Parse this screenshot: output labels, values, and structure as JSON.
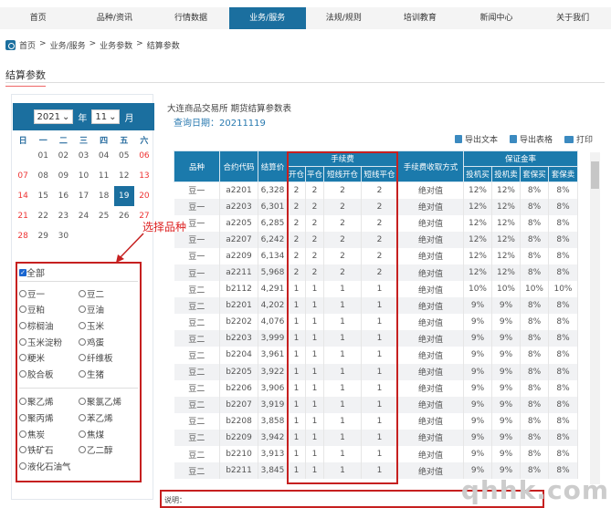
{
  "nav": [
    "首页",
    "品种/资讯",
    "行情数据",
    "业务/服务",
    "法规/规则",
    "培训教育",
    "新闻中心",
    "关于我们"
  ],
  "nav_active": 3,
  "breadcrumb": [
    "首页",
    ">",
    "业务/服务",
    ">",
    "业务参数",
    ">",
    "结算参数"
  ],
  "page_title": "结算参数",
  "calendar": {
    "year": "2021",
    "year_unit": "年",
    "month": "11",
    "month_unit": "月",
    "weekdays": [
      "日",
      "一",
      "二",
      "三",
      "四",
      "五",
      "六"
    ],
    "weeks": [
      [
        "",
        "01",
        "02",
        "03",
        "04",
        "05",
        "06"
      ],
      [
        "07",
        "08",
        "09",
        "10",
        "11",
        "12",
        "13"
      ],
      [
        "14",
        "15",
        "16",
        "17",
        "18",
        "19",
        "20"
      ],
      [
        "21",
        "22",
        "23",
        "24",
        "25",
        "26",
        "27"
      ],
      [
        "28",
        "29",
        "30",
        "",
        "",
        "",
        ""
      ]
    ],
    "selected": "19"
  },
  "annotation": "选择品种",
  "varieties": {
    "all_label": "全部",
    "all_checked": true,
    "group1": [
      "豆一",
      "豆二",
      "豆粕",
      "豆油",
      "棕榈油",
      "玉米",
      "玉米淀粉",
      "鸡蛋",
      "粳米",
      "纤维板",
      "胶合板",
      "生猪"
    ],
    "group2": [
      "聚乙烯",
      "聚氯乙烯",
      "聚丙烯",
      "苯乙烯",
      "焦炭",
      "焦煤",
      "铁矿石",
      "乙二醇",
      "液化石油气"
    ]
  },
  "report": {
    "title": "大连商品交易所 期货结算参数表",
    "query_date": "查询日期：20211119"
  },
  "toolbar": {
    "export_text": "导出文本",
    "export_table": "导出表格",
    "print": "打印"
  },
  "table": {
    "h_variety": "品种",
    "h_contract": "合约代码",
    "h_price": "结算价",
    "h_fee": "手续费",
    "h_fee_method": "手续费收取方式",
    "h_margin": "保证金率",
    "fee_sub": [
      "开仓",
      "平仓",
      "短线开仓",
      "短线平仓"
    ],
    "margin_sub": [
      "投机买",
      "投机卖",
      "套保买",
      "套保卖"
    ],
    "rows": [
      [
        "豆一",
        "a2201",
        "6,328",
        "2",
        "2",
        "2",
        "2",
        "绝对值",
        "12%",
        "12%",
        "8%",
        "8%"
      ],
      [
        "豆一",
        "a2203",
        "6,301",
        "2",
        "2",
        "2",
        "2",
        "绝对值",
        "12%",
        "12%",
        "8%",
        "8%"
      ],
      [
        "豆一",
        "a2205",
        "6,285",
        "2",
        "2",
        "2",
        "2",
        "绝对值",
        "12%",
        "12%",
        "8%",
        "8%"
      ],
      [
        "豆一",
        "a2207",
        "6,242",
        "2",
        "2",
        "2",
        "2",
        "绝对值",
        "12%",
        "12%",
        "8%",
        "8%"
      ],
      [
        "豆一",
        "a2209",
        "6,134",
        "2",
        "2",
        "2",
        "2",
        "绝对值",
        "12%",
        "12%",
        "8%",
        "8%"
      ],
      [
        "豆一",
        "a2211",
        "5,968",
        "2",
        "2",
        "2",
        "2",
        "绝对值",
        "12%",
        "12%",
        "8%",
        "8%"
      ],
      [
        "豆二",
        "b2112",
        "4,291",
        "1",
        "1",
        "1",
        "1",
        "绝对值",
        "10%",
        "10%",
        "10%",
        "10%"
      ],
      [
        "豆二",
        "b2201",
        "4,202",
        "1",
        "1",
        "1",
        "1",
        "绝对值",
        "9%",
        "9%",
        "8%",
        "8%"
      ],
      [
        "豆二",
        "b2202",
        "4,076",
        "1",
        "1",
        "1",
        "1",
        "绝对值",
        "9%",
        "9%",
        "8%",
        "8%"
      ],
      [
        "豆二",
        "b2203",
        "3,999",
        "1",
        "1",
        "1",
        "1",
        "绝对值",
        "9%",
        "9%",
        "8%",
        "8%"
      ],
      [
        "豆二",
        "b2204",
        "3,961",
        "1",
        "1",
        "1",
        "1",
        "绝对值",
        "9%",
        "9%",
        "8%",
        "8%"
      ],
      [
        "豆二",
        "b2205",
        "3,922",
        "1",
        "1",
        "1",
        "1",
        "绝对值",
        "9%",
        "9%",
        "8%",
        "8%"
      ],
      [
        "豆二",
        "b2206",
        "3,906",
        "1",
        "1",
        "1",
        "1",
        "绝对值",
        "9%",
        "9%",
        "8%",
        "8%"
      ],
      [
        "豆二",
        "b2207",
        "3,919",
        "1",
        "1",
        "1",
        "1",
        "绝对值",
        "9%",
        "9%",
        "8%",
        "8%"
      ],
      [
        "豆二",
        "b2208",
        "3,858",
        "1",
        "1",
        "1",
        "1",
        "绝对值",
        "9%",
        "9%",
        "8%",
        "8%"
      ],
      [
        "豆二",
        "b2209",
        "3,942",
        "1",
        "1",
        "1",
        "1",
        "绝对值",
        "9%",
        "9%",
        "8%",
        "8%"
      ],
      [
        "豆二",
        "b2210",
        "3,913",
        "1",
        "1",
        "1",
        "1",
        "绝对值",
        "9%",
        "9%",
        "8%",
        "8%"
      ],
      [
        "豆二",
        "b2211",
        "3,845",
        "1",
        "1",
        "1",
        "1",
        "绝对值",
        "9%",
        "9%",
        "8%",
        "8%"
      ]
    ]
  },
  "note_label": "说明：",
  "watermark": "qhhk.com",
  "colors": {
    "primary": "#1b6f9f",
    "highlight": "#c62020",
    "weekend": "#e33333"
  }
}
